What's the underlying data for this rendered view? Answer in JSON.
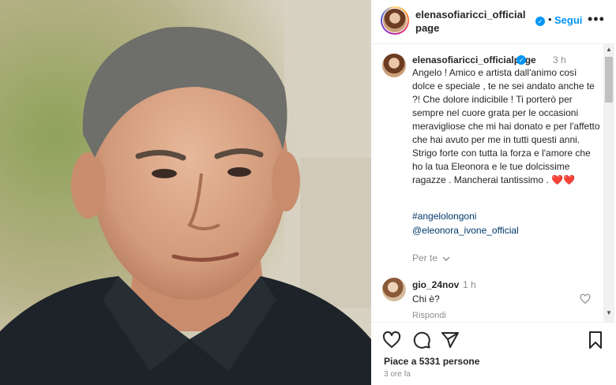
{
  "header": {
    "username": "elenasofiaricci_officialpage",
    "separator": "•",
    "follow_label": "Segui",
    "more_label": "•••"
  },
  "post": {
    "author": "elenasofiaricci_officialpage",
    "time": "3 h",
    "caption": "Angelo ! Amico e artista dall'animo così dolce e speciale , te ne sei andato anche te ?! Che dolore indicibile ! Ti porterò per sempre nel cuore grata per le occasioni meravigliose che mi hai donato e per l'affetto che hai avuto per me in tutti questi anni. Strigo forte con tutta la forza e l'amore che ho la tua Eleonora e le tue dolcissime ragazze . Mancherai tantissimo .",
    "hearts": "❤️❤️",
    "hashtag": "#angelolongoni",
    "mention": "@eleonora_ivone_official",
    "translate_label": "Per te"
  },
  "comments": [
    {
      "user": "gio_24nov",
      "time": "1 h",
      "text": "Chi è?",
      "reply_label": "Rispondi"
    }
  ],
  "footer": {
    "likes": "Piace a 5331 persone",
    "ago": "3 ore fa"
  },
  "icons": [
    "heart-icon",
    "comment-icon",
    "share-icon",
    "bookmark-icon",
    "verified-icon",
    "chevron-down-icon"
  ],
  "colors": {
    "accent": "#0095f6",
    "text": "#262626",
    "muted": "#8e8e8e",
    "link": "#00376b"
  }
}
